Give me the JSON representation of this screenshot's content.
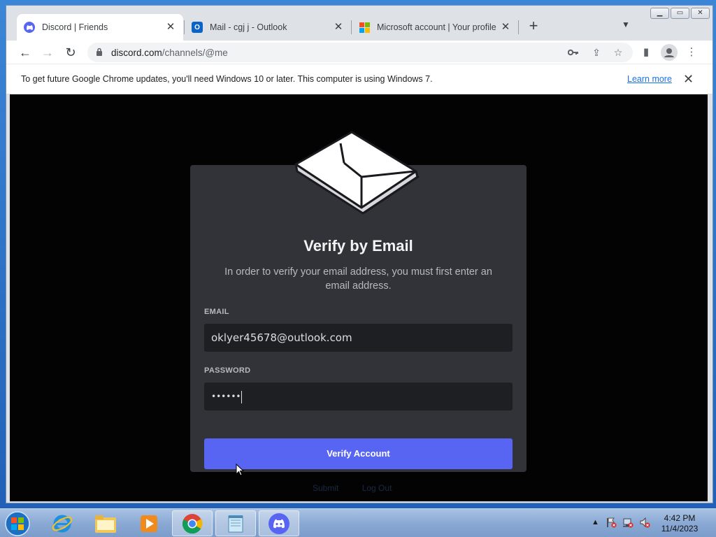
{
  "browser": {
    "tabs": [
      {
        "title": "Discord | Friends",
        "icon": "discord-icon",
        "active": true
      },
      {
        "title": "Mail - cgj j - Outlook",
        "icon": "outlook-icon",
        "active": false
      },
      {
        "title": "Microsoft account | Your profile",
        "icon": "microsoft-icon",
        "active": false
      }
    ],
    "new_tab": "+",
    "address": {
      "host": "discord.com",
      "path": "/channels/@me"
    },
    "infobar": {
      "message": "To get future Google Chrome updates, you'll need Windows 10 or later. This computer is using Windows 7.",
      "link": "Learn more"
    }
  },
  "modal": {
    "title": "Verify by Email",
    "subtitle": "In order to verify your email address, you must first enter an email address.",
    "email_label": "EMAIL",
    "email_value": "oklyer45678@outlook.com",
    "password_label": "PASSWORD",
    "password_value": "••••••",
    "submit_label": "Verify Account"
  },
  "background_links": [
    "Submit",
    "Log Out"
  ],
  "colors": {
    "discord_blurple": "#5865f2",
    "modal_bg": "#313338",
    "input_bg": "#1e1f22",
    "page_bg": "#030304"
  },
  "taskbar": {
    "apps": [
      "internet-explorer-icon",
      "file-explorer-icon",
      "media-player-icon",
      "chrome-icon",
      "notepad-icon",
      "discord-icon"
    ],
    "clock": {
      "time": "4:42 PM",
      "date": "11/4/2023"
    }
  }
}
